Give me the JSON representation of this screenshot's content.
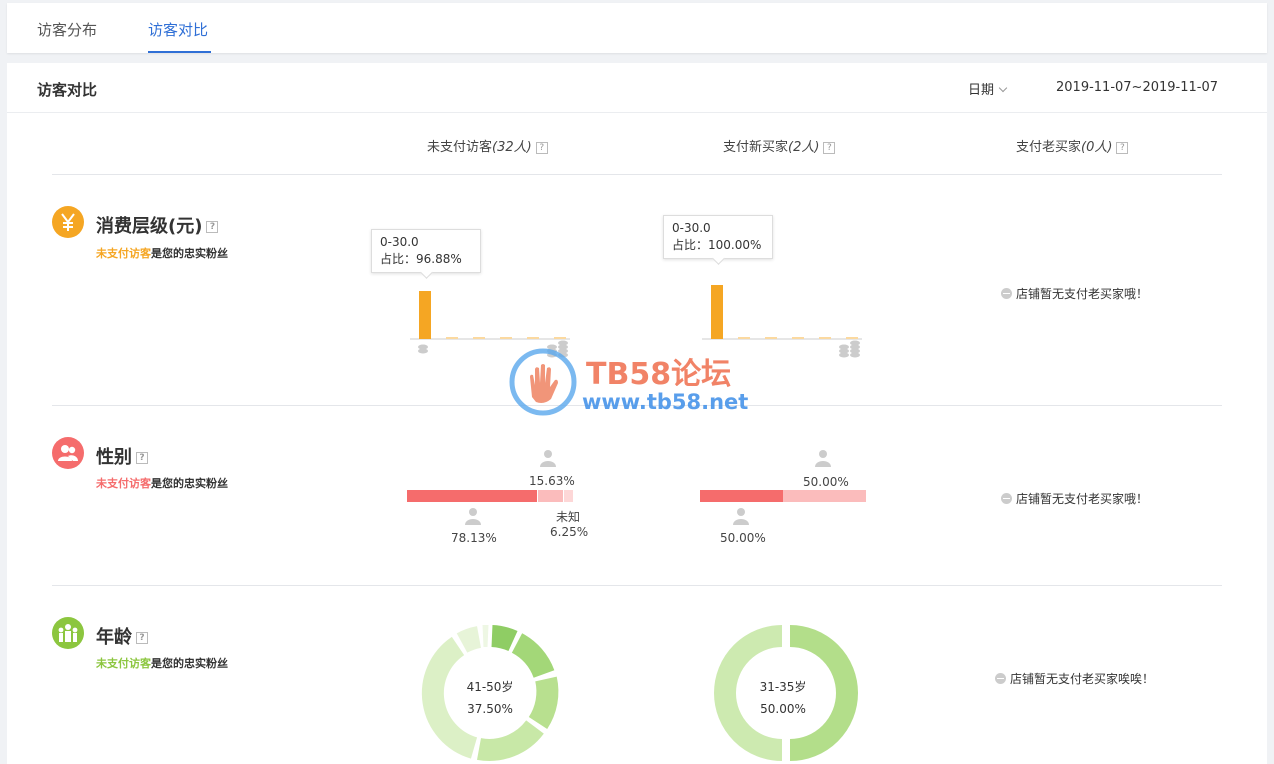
{
  "tabs": [
    {
      "label": "访客分布",
      "active": false
    },
    {
      "label": "访客对比",
      "active": true
    }
  ],
  "header": {
    "title": "访客对比",
    "date_label": "日期",
    "date_range": "2019-11-07~2019-11-07"
  },
  "columns": [
    {
      "label": "未支付访客",
      "count": "(32人)"
    },
    {
      "label": "支付新买家",
      "count": "(2人)"
    },
    {
      "label": "支付老买家",
      "count": "(0人)"
    }
  ],
  "rows": {
    "consumption": {
      "title": "消费层级(元)",
      "icon": "yen-icon",
      "color": "#f5a623",
      "sub_highlight": "未支付访客",
      "sub_rest": "是您的忠实粉丝",
      "col1": {
        "tooltip_range": "0-30.0",
        "tooltip_share": "占比：96.88%"
      },
      "col2": {
        "tooltip_range": "0-30.0",
        "tooltip_share": "占比：100.00%"
      },
      "col3_empty": "店铺暂无支付老买家哦！"
    },
    "gender": {
      "title": "性别",
      "icon": "users-icon",
      "color": "#f56c6c",
      "sub_highlight": "未支付访客",
      "sub_rest": "是您的忠实粉丝",
      "col1": {
        "male_pct": "78.13%",
        "female_pct": "15.63%",
        "unknown_label": "未知",
        "unknown_pct": "6.25%"
      },
      "col2": {
        "male_pct": "50.00%",
        "female_pct": "50.00%"
      },
      "col3_empty": "店铺暂无支付老买家哦！"
    },
    "age": {
      "title": "年龄",
      "icon": "family-icon",
      "color": "#8cc63f",
      "sub_highlight": "未支付访客",
      "sub_rest": "是您的忠实粉丝",
      "col1": {
        "label": "41-50岁",
        "pct": "37.50%"
      },
      "col2": {
        "label": "31-35岁",
        "pct": "50.00%"
      },
      "col3_empty": "店铺暂无支付老买家唉唉！"
    }
  },
  "watermark": {
    "title": "TB58论坛",
    "url": "www.tb58.net"
  }
}
